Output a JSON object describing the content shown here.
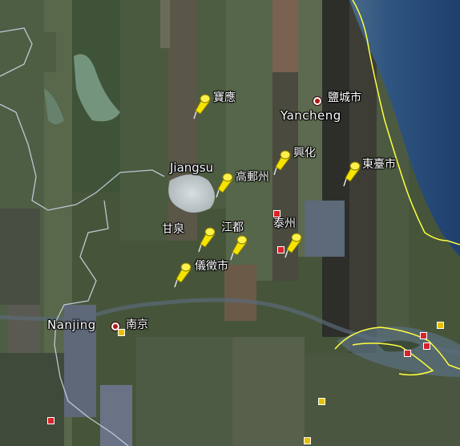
{
  "map": {
    "region": "Jiangsu",
    "cities": [
      {
        "id": "yancheng_cn",
        "label": "鹽城市"
      },
      {
        "id": "yancheng_en",
        "label": "Yancheng"
      },
      {
        "id": "nanjing_en",
        "label": "Nanjing"
      },
      {
        "id": "nanjing_cn",
        "label": "南京"
      }
    ],
    "placemarks": [
      {
        "id": "baoying",
        "label": "寶應"
      },
      {
        "id": "xinghua",
        "label": "興化"
      },
      {
        "id": "dongtai",
        "label": "東臺市"
      },
      {
        "id": "gaoyou",
        "label": "高郵州"
      },
      {
        "id": "ganquan",
        "label": "甘泉"
      },
      {
        "id": "jiangdu",
        "label": "江都"
      },
      {
        "id": "taizhou",
        "label": "泰州"
      },
      {
        "id": "yizheng",
        "label": "儀徵市"
      }
    ],
    "colors": {
      "province_border": "#c9d3e0",
      "coast_border": "#ffff3c",
      "pin": "#f5e400",
      "sea": "#2e4f7d"
    }
  }
}
